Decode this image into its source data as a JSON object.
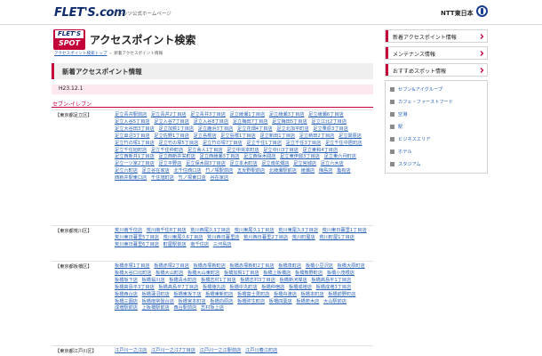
{
  "header": {
    "logo": "FLET'S.com",
    "subtitle": "フレッツ公式ホームページ",
    "corp": "NTT東日本"
  },
  "title": {
    "logo_line1": "FLET'S",
    "logo_line2": "SPOT",
    "text": "アクセスポイント検索"
  },
  "breadcrumb": {
    "link": "アクセスポイント検索トップ",
    "current": "新着アクセスポイント情報"
  },
  "section": {
    "title": "新着アクセスポイント情報",
    "date": "H23.12.1",
    "brand": "セブン-イレブン"
  },
  "wards": [
    {
      "name": "【東京都足立区】",
      "stores": [
        "足立青井駅前店",
        "足立青井2丁目店",
        "足立青井3丁目店",
        "足立綾瀬1丁目店",
        "足立綾瀬3丁目店",
        "足立綾瀬6丁目店",
        "足立入谷5丁目店",
        "足立入谷7丁目店",
        "足立入谷8丁目店",
        "足立梅田7丁目店",
        "足立梅田5丁目店",
        "足立江北2丁目店",
        "足立大谷田3丁目店",
        "足立加賀1丁目店",
        "足立鹿浜3丁目店",
        "足立花畑4丁目店",
        "足立北加平町店",
        "足立栗原3丁目店",
        "足立皿沼3丁目店",
        "足立佐野1丁目店",
        "足立島根店",
        "足立島根1丁目店",
        "足立新田1丁目店",
        "足立新田2丁目店",
        "足立関原店",
        "足立竹の塚1丁目店",
        "足立竹の塚5丁目店",
        "足立竹の塚7丁目店",
        "足立千住1丁目店",
        "足立千住3丁目店",
        "足立千住中居町店",
        "足立千住旭町店",
        "足立千住仲町店",
        "足立舎人1丁目店",
        "足立中央本町店",
        "足立中川3丁目店",
        "足立東和4丁目店",
        "足立西新井1丁目店",
        "足立西新井栄町店",
        "足立西綾瀬3丁目店",
        "足立西保木間店",
        "足立東伊興3丁目店",
        "足立東六月町店",
        "足立一ツ家2丁目店",
        "足立平野店",
        "足立保木間3丁目店",
        "足立本木町店",
        "足立南花畑店",
        "足立宮城店",
        "足立六木店",
        "足立六町店",
        "足立谷在家店",
        "北千住西口店",
        "竹ノ塚駅前店",
        "五反野駅前店",
        "北綾瀬駅前店",
        "綾瀬店",
        "梅島店",
        "亀有店",
        "西新井駅東口店",
        "千住旭町店",
        "竹ノ塚東口店",
        "谷在家店"
      ]
    },
    {
      "name": "【東京都荒川区】",
      "stores": [
        "荒川南千住店",
        "荒川南千住8丁目店",
        "荒川西尾久3丁目店",
        "荒川東尾久1丁目店",
        "荒川東尾久3丁目店",
        "荒川東日暮里1丁目店",
        "荒川東日暮里5丁目店",
        "荒川東尾久6丁目店",
        "荒川西日暮里店",
        "荒川西日暮里2丁目店",
        "荒川町屋店",
        "荒川町屋1丁目店",
        "荒川東日暮里6丁目店",
        "町屋駅前店",
        "南千住店",
        "三河島店"
      ]
    },
    {
      "name": "【東京都板橋区】",
      "stores": [
        "板橋赤塚1丁目店",
        "板橋赤塚2丁目店",
        "板橋赤塚新町店",
        "板橋赤塚新町2丁目店",
        "板橋泉町店",
        "板橋小豆沢店",
        "板橋大原町店",
        "板橋大谷口北町店",
        "板橋大山町店",
        "板橋大山東町店",
        "板橋加賀1丁目店",
        "板橋上板橋店",
        "板橋熊野町店",
        "板橋小茂根店",
        "板橋坂下店",
        "板橋桜川店",
        "板橋清水町店",
        "板橋志村1丁目店",
        "板橋志村3丁目店",
        "板橋新河岸店",
        "板橋高島平1丁目店",
        "板橋高島平3丁目店",
        "板橋高島平7丁目店",
        "板橋徳丸店",
        "板橋中丸町店",
        "板橋仲宿店",
        "板橋成増店",
        "板橋成増3丁目店",
        "板橋西台店",
        "板橋蓮沼町店",
        "板橋東坂下店",
        "板橋東新町店",
        "板橋富士見町店",
        "板橋舟渡店",
        "板橋本町店",
        "板橋前野町店",
        "板橋三園店",
        "板橋南常盤台店",
        "板橋宮本町店",
        "板橋向原店",
        "板橋弥生町店",
        "板橋四葉店",
        "板橋若木店",
        "大山駅前店",
        "成増駅前店",
        "上板橋駅前店",
        "西台駅前店",
        "志村坂上店"
      ]
    },
    {
      "name": "【東京都江戸川区】",
      "stores": [
        "江戸川一之江店",
        "江戸川一之江7丁目店",
        "江戸川一之江駅前店",
        "江戸川春江町店"
      ]
    }
  ],
  "sidebar": {
    "btn_new": "新着アクセスポイント情報",
    "btn_maint": "メンテナンス情報",
    "box_title": "おすすめスポット情報",
    "links": [
      "セブン&アイグループ",
      "カフェ・ファーストフード",
      "空港",
      "駅",
      "ビジネスエリア",
      "ホテル",
      "スタジアム"
    ]
  }
}
